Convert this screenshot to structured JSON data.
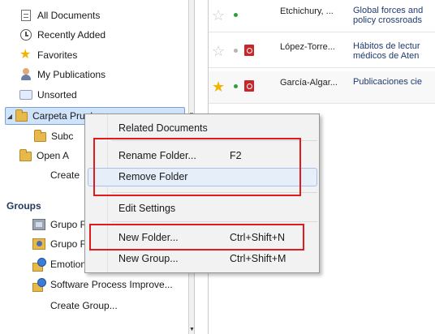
{
  "sidebar": {
    "library_items": [
      {
        "label": "All Documents"
      },
      {
        "label": "Recently Added"
      },
      {
        "label": "Favorites"
      },
      {
        "label": "My Publications"
      },
      {
        "label": "Unsorted"
      }
    ],
    "folders": [
      {
        "label": "Carpeta Prueba"
      },
      {
        "label": "Subc"
      },
      {
        "label": "Open A"
      },
      {
        "label": "Create"
      }
    ],
    "groups_header": "Groups",
    "groups": [
      {
        "label": "Grupo F"
      },
      {
        "label": "Grupo F"
      },
      {
        "label": "Emotion"
      },
      {
        "label": "Software Process Improve..."
      },
      {
        "label": "Create Group..."
      }
    ]
  },
  "documents": [
    {
      "authors": "Etchichury, ...",
      "title_line1": "Global forces and",
      "title_line2": "policy crossroads",
      "favorite": false,
      "read_status_color": "#2e9e3c",
      "has_pdf": false
    },
    {
      "authors": "López-Torre...",
      "title_line1": "Hábitos de lectur",
      "title_line2": "médicos de Aten",
      "favorite": false,
      "read_status_color": "#b5b5b5",
      "has_pdf": true
    },
    {
      "authors": "García-Algar...",
      "title_line1": "Publicaciones cie",
      "title_line2": "",
      "favorite": true,
      "read_status_color": "#2e9e3c",
      "has_pdf": true
    }
  ],
  "context_menu": {
    "items": [
      {
        "label": "Related Documents",
        "shortcut": ""
      },
      {
        "label": "Rename Folder...",
        "shortcut": "F2"
      },
      {
        "label": "Remove Folder",
        "shortcut": ""
      },
      {
        "label": "Edit Settings",
        "shortcut": ""
      },
      {
        "label": "New Folder...",
        "shortcut": "Ctrl+Shift+N"
      },
      {
        "label": "New Group...",
        "shortcut": "Ctrl+Shift+M"
      }
    ]
  },
  "colors": {
    "selection": "#cfe3fb",
    "highlight_box": "#e01b1b",
    "group_header": "#1e395b",
    "favorite_star": "#f3b400"
  }
}
